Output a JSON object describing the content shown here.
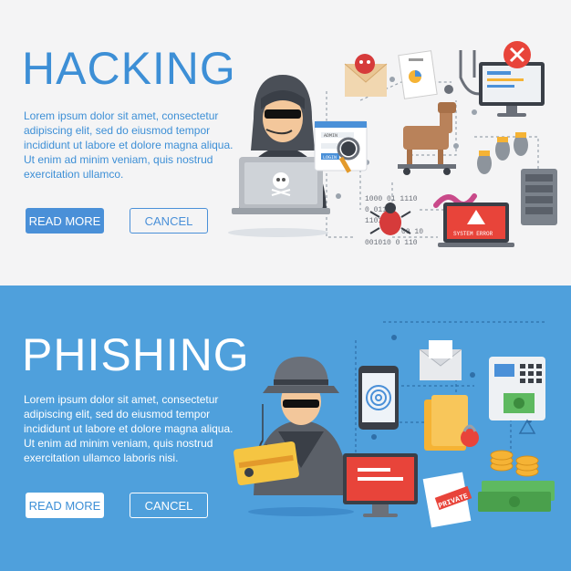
{
  "hacking": {
    "title": "HACKING",
    "body": "Lorem ipsum dolor sit amet, consectetur adipiscing elit, sed do eiusmod tempor incididunt ut labore et dolore magna aliqua. Ut enim ad minim veniam, quis nostrud exercitation ullamco.",
    "read_more": "READ MORE",
    "cancel": "CANCEL",
    "illustration": {
      "admin_label": "ADMIN",
      "login_label": "LOGIN",
      "binary_lines": [
        "1000 01 1110",
        "0 01110",
        "1101",
        "00 10",
        "001010 0 110"
      ],
      "system_error": "SYSTEM ERROR"
    }
  },
  "phishing": {
    "title": "PHISHING",
    "body": "Lorem ipsum dolor sit amet, consectetur adipiscing elit, sed do eiusmod tempor incididunt ut labore et dolore magna aliqua. Ut enim ad minim veniam, quis nostrud exercitation ullamco laboris nisi.",
    "read_more": "READ MORE",
    "cancel": "CANCEL",
    "illustration": {
      "private_label": "PRIVATE"
    }
  },
  "colors": {
    "top_background": "#f4f4f5",
    "bottom_background": "#4fa0dc",
    "accent_blue": "#3d8fd6",
    "error_red": "#e8443a"
  }
}
